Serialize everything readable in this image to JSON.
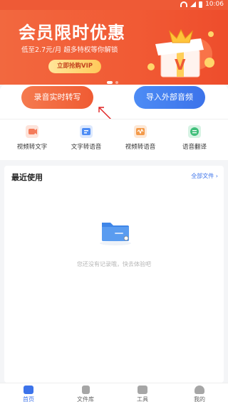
{
  "status_bar": {
    "time": "10:06"
  },
  "banner": {
    "title": "会员限时优惠",
    "subtitle": "低至2.7元/月  超多特权等你解锁",
    "cta_label": "立即抢购VIP"
  },
  "actions": {
    "record_label": "录音实时转写",
    "import_label": "导入外部音频"
  },
  "tools": [
    {
      "label": "视频转文字",
      "icon": "video-to-text-icon",
      "color": "#f47b5a"
    },
    {
      "label": "文字转语音",
      "icon": "text-to-speech-icon",
      "color": "#4d8cf5"
    },
    {
      "label": "视频转语音",
      "icon": "video-to-audio-icon",
      "color": "#f39a4a"
    },
    {
      "label": "语音翻译",
      "icon": "voice-translate-icon",
      "color": "#3fbf7a"
    }
  ],
  "recent": {
    "title": "最近使用",
    "all_files_label": "全部文件 ›",
    "empty_text": "您还没有记录哦，快去体验吧"
  },
  "tabbar": [
    {
      "label": "首页",
      "icon": "home-icon",
      "active": true
    },
    {
      "label": "文件库",
      "icon": "file-library-icon",
      "active": false
    },
    {
      "label": "工具",
      "icon": "toolbox-icon",
      "active": false
    },
    {
      "label": "我的",
      "icon": "profile-icon",
      "active": false
    }
  ],
  "colors": {
    "accent_orange": "#ef5b33",
    "accent_blue": "#3c73ea"
  }
}
